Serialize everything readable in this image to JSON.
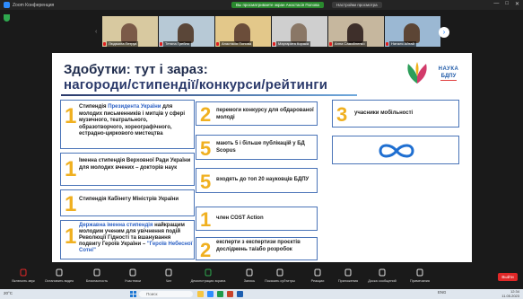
{
  "window": {
    "app_title": "Zoom Конференция",
    "share_banner": "Вы просматриваете экран Анастасія Попова",
    "view_options": "Настройки просмотра",
    "min": "—",
    "max": "□",
    "close": "✕"
  },
  "participants": [
    {
      "name": "Людмила Петрук",
      "bg": "#d8c9a0",
      "person": "#7b5a48"
    },
    {
      "name": "Тетяна Гребля",
      "bg": "#b7c9d6",
      "person": "#5a4638"
    },
    {
      "name": "Анастасія Попова",
      "bg": "#e3c88a",
      "person": "#6b4d3a"
    },
    {
      "name": "Маргарита Корака",
      "bg": "#cfcfcf",
      "person": "#8a7766"
    },
    {
      "name": "Анна Самойленко",
      "bg": "#c6b79e",
      "person": "#3e2f2a"
    },
    {
      "name": "Наталя Айтай",
      "bg": "#9bb8d3",
      "person": "#5c4535"
    }
  ],
  "slide": {
    "heading_line1": "Здобутки: тут і зараз:",
    "heading_line2": "нагороди/стипендії/конкурси/рейтинги",
    "logo_text_1": "НАУКА",
    "logo_text_2": "БДПУ",
    "items": [
      {
        "num": "1",
        "text_plain": "Стипендія ",
        "text_hl": "Президента України",
        "text_rest": " для молодих письменників і митців у сфері музичного, театрального, образотворчого, хореографічного, естрадно-циркового мистецтва"
      },
      {
        "num": "1",
        "text": "Іменна стипендія Верховної Ради України для молодих вчених – докторів наук"
      },
      {
        "num": "1",
        "text": "Стипендія Кабінету Міністрів України"
      },
      {
        "num": "1",
        "text_hl": "Державна іменна стипендія",
        "text_rest": " найкращим молодим ученим для увічнення подій Революції Гідності та вшанування подвигу Героїв України – ",
        "text_hl2": "\"Героїв Небесної Сотні\""
      },
      {
        "num": "2",
        "text": "перемоги конкурсу для обдарованої молоді"
      },
      {
        "num": "5",
        "text": "мають 5 і більше публікацій у БД Scopus"
      },
      {
        "num": "5",
        "text": "входять до топ 20 науковців БДПУ"
      },
      {
        "num": "1",
        "text": "член COST Action"
      },
      {
        "num": "2",
        "text": "експерти з експертизи проєктів досліджень та/або розробок"
      },
      {
        "num": "3",
        "text": "учасники мобільності"
      }
    ]
  },
  "toolbar": [
    {
      "label": "Включить звук",
      "icon": "mic-off-icon",
      "color": "#e02828"
    },
    {
      "label": "Остановить видео",
      "icon": "video-icon",
      "color": "#ddd"
    },
    {
      "label": "Безопасность",
      "icon": "shield-icon",
      "color": "#ddd"
    },
    {
      "label": "Участники",
      "icon": "participants-icon",
      "color": "#ddd"
    },
    {
      "label": "Чат",
      "icon": "chat-icon",
      "color": "#ddd"
    },
    {
      "label": "Демонстрация экрана",
      "icon": "share-screen-icon",
      "color": "#2fa84f"
    },
    {
      "label": "Запись",
      "icon": "record-icon",
      "color": "#ddd"
    },
    {
      "label": "Показать субтитры",
      "icon": "captions-icon",
      "color": "#ddd"
    },
    {
      "label": "Реакции",
      "icon": "reactions-icon",
      "color": "#ddd"
    },
    {
      "label": "Приложения",
      "icon": "apps-icon",
      "color": "#ddd"
    },
    {
      "label": "Доска сообщений",
      "icon": "whiteboard-icon",
      "color": "#ddd"
    },
    {
      "label": "Примечания",
      "icon": "notes-icon",
      "color": "#ddd"
    }
  ],
  "end_button": "Выйти",
  "taskbar": {
    "weather": "20°C",
    "search_placeholder": "Поиск",
    "tray": "ENG",
    "time": "12:34",
    "date": "11.05.2023"
  }
}
